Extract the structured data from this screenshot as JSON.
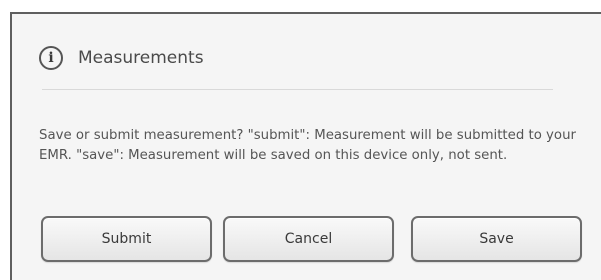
{
  "dialog": {
    "title": "Measurements",
    "icon": "info-icon",
    "message": "Save or submit measurement? \"submit\": Measurement will be submitted to your EMR. \"save\": Measurement will be saved on this device only, not sent."
  },
  "buttons": {
    "submit_label": "Submit",
    "cancel_label": "Cancel",
    "save_label": "Save"
  }
}
